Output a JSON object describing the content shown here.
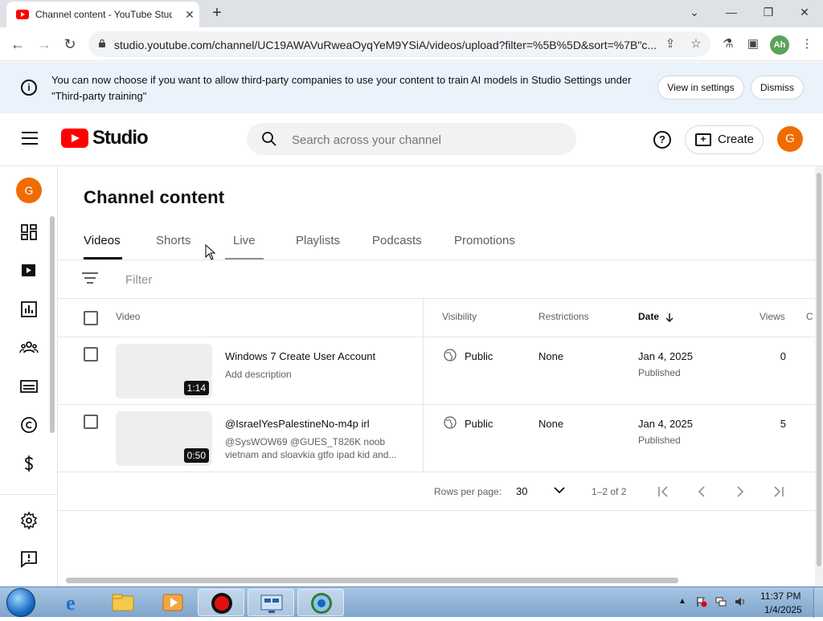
{
  "browser": {
    "tab_title": "Channel content - YouTube Studio",
    "url": "studio.youtube.com/channel/UC19AWAVuRweaOyqYeM9YSiA/videos/upload?filter=%5B%5D&sort=%7B\"c...",
    "profile_initials": "Ah",
    "window_controls": [
      "chevron-down-icon",
      "minimize-icon",
      "restore-icon",
      "close-icon"
    ]
  },
  "banner": {
    "text": "You can now choose if you want to allow third-party companies to use your content to train AI models in Studio Settings under \"Third-party training\"",
    "view_settings_label": "View in settings",
    "dismiss_label": "Dismiss"
  },
  "header": {
    "logo_text": "Studio",
    "search_placeholder": "Search across your channel",
    "help_glyph": "?",
    "create_label": "Create",
    "avatar_initial": "G"
  },
  "rail": {
    "avatar_initial": "G",
    "items": [
      "dashboard-icon",
      "content-icon",
      "analytics-icon",
      "community-icon",
      "subtitles-icon",
      "copyright-icon",
      "earn-icon",
      "settings-icon",
      "feedback-icon"
    ]
  },
  "main": {
    "title": "Channel content",
    "tabs": [
      {
        "label": "Videos"
      },
      {
        "label": "Shorts"
      },
      {
        "label": "Live"
      },
      {
        "label": "Playlists"
      },
      {
        "label": "Podcasts"
      },
      {
        "label": "Promotions"
      }
    ],
    "active_tab": "Videos",
    "filter_placeholder": "Filter",
    "columns": {
      "video": "Video",
      "visibility": "Visibility",
      "restrictions": "Restrictions",
      "date": "Date",
      "views": "Views",
      "comments": "C"
    },
    "rows": [
      {
        "duration": "1:14",
        "title": "Windows 7 Create User Account",
        "description": "Add description",
        "visibility": "Public",
        "restrictions": "None",
        "date": "Jan 4, 2025",
        "status": "Published",
        "views": "0"
      },
      {
        "duration": "0:50",
        "title": "@IsraelYesPalestineNo-m4p irl",
        "description": "@SysWOW69 @GUES_T826K noob vietnam and sloavkia gtfo ipad kid and...",
        "visibility": "Public",
        "restrictions": "None",
        "date": "Jan 4, 2025",
        "status": "Published",
        "views": "5"
      }
    ],
    "pagination": {
      "rows_per_page_label": "Rows per page:",
      "rows_per_page_value": "30",
      "range": "1–2 of 2"
    }
  },
  "taskbar": {
    "time": "11:37 PM",
    "date": "1/4/2025"
  },
  "colors": {
    "brand_red": "#ff0000",
    "avatar_orange": "#ef6c00",
    "banner_bg": "#eaf2fb"
  }
}
